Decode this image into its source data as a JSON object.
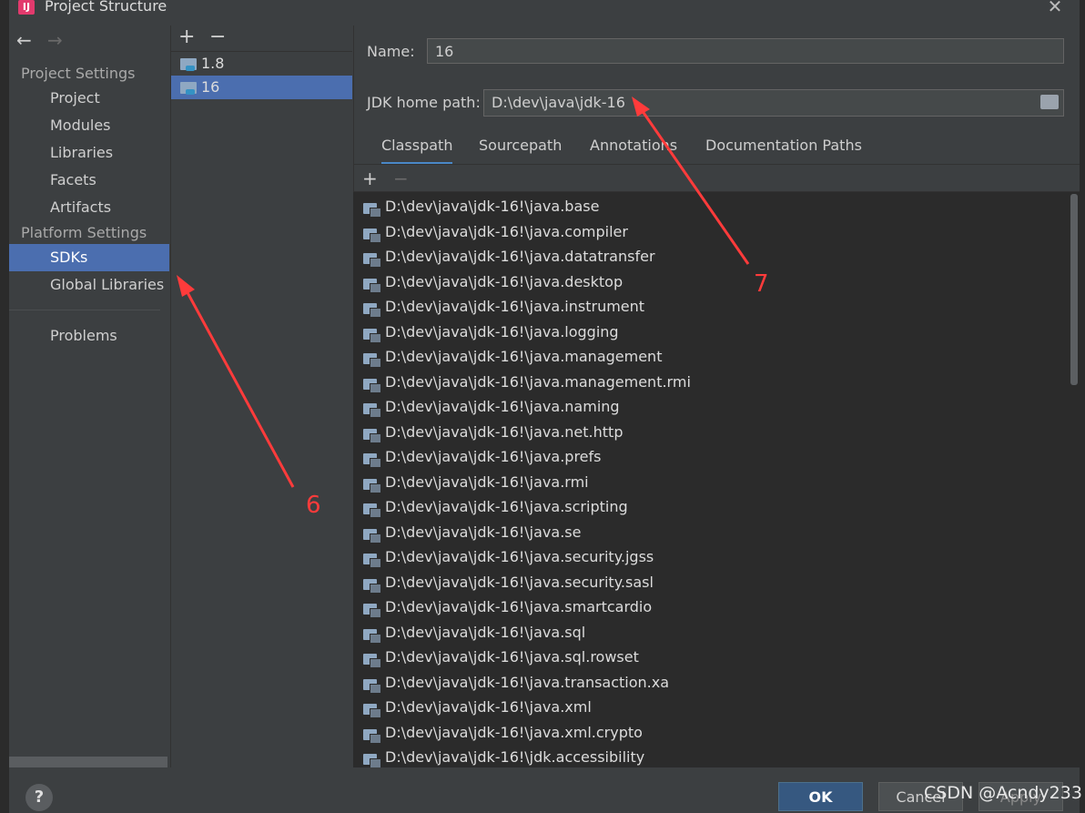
{
  "window": {
    "title": "Project Structure",
    "app_icon_label": "IJ"
  },
  "nav": {
    "back_icon": "arrow-left-icon",
    "forward_icon": "arrow-right-icon",
    "project_settings_header": "Project Settings",
    "project_items": [
      "Project",
      "Modules",
      "Libraries",
      "Facets",
      "Artifacts"
    ],
    "platform_settings_header": "Platform Settings",
    "platform_items": [
      "SDKs",
      "Global Libraries"
    ],
    "selected": "SDKs",
    "problems": "Problems"
  },
  "sdk_list": {
    "add_label": "+",
    "remove_label": "−",
    "items": [
      "1.8",
      "16"
    ],
    "selected": "16"
  },
  "details": {
    "name_label": "Name:",
    "name_value": "16",
    "jdk_home_label": "JDK home path:",
    "jdk_home_value": "D:\\dev\\java\\jdk-16",
    "tabs": [
      "Classpath",
      "Sourcepath",
      "Annotations",
      "Documentation Paths"
    ],
    "active_tab": "Classpath",
    "add_label": "+",
    "remove_label": "−",
    "classpath_entries": [
      "D:\\dev\\java\\jdk-16!\\java.base",
      "D:\\dev\\java\\jdk-16!\\java.compiler",
      "D:\\dev\\java\\jdk-16!\\java.datatransfer",
      "D:\\dev\\java\\jdk-16!\\java.desktop",
      "D:\\dev\\java\\jdk-16!\\java.instrument",
      "D:\\dev\\java\\jdk-16!\\java.logging",
      "D:\\dev\\java\\jdk-16!\\java.management",
      "D:\\dev\\java\\jdk-16!\\java.management.rmi",
      "D:\\dev\\java\\jdk-16!\\java.naming",
      "D:\\dev\\java\\jdk-16!\\java.net.http",
      "D:\\dev\\java\\jdk-16!\\java.prefs",
      "D:\\dev\\java\\jdk-16!\\java.rmi",
      "D:\\dev\\java\\jdk-16!\\java.scripting",
      "D:\\dev\\java\\jdk-16!\\java.se",
      "D:\\dev\\java\\jdk-16!\\java.security.jgss",
      "D:\\dev\\java\\jdk-16!\\java.security.sasl",
      "D:\\dev\\java\\jdk-16!\\java.smartcardio",
      "D:\\dev\\java\\jdk-16!\\java.sql",
      "D:\\dev\\java\\jdk-16!\\java.sql.rowset",
      "D:\\dev\\java\\jdk-16!\\java.transaction.xa",
      "D:\\dev\\java\\jdk-16!\\java.xml",
      "D:\\dev\\java\\jdk-16!\\java.xml.crypto",
      "D:\\dev\\java\\jdk-16!\\jdk.accessibility"
    ]
  },
  "buttons": {
    "help": "?",
    "ok": "OK",
    "cancel": "Cancel",
    "apply": "Apply"
  },
  "annotations": {
    "arrow_6_label": "6",
    "arrow_7_label": "7",
    "color": "#ff3b3b"
  },
  "watermark": "CSDN @Acndy233"
}
